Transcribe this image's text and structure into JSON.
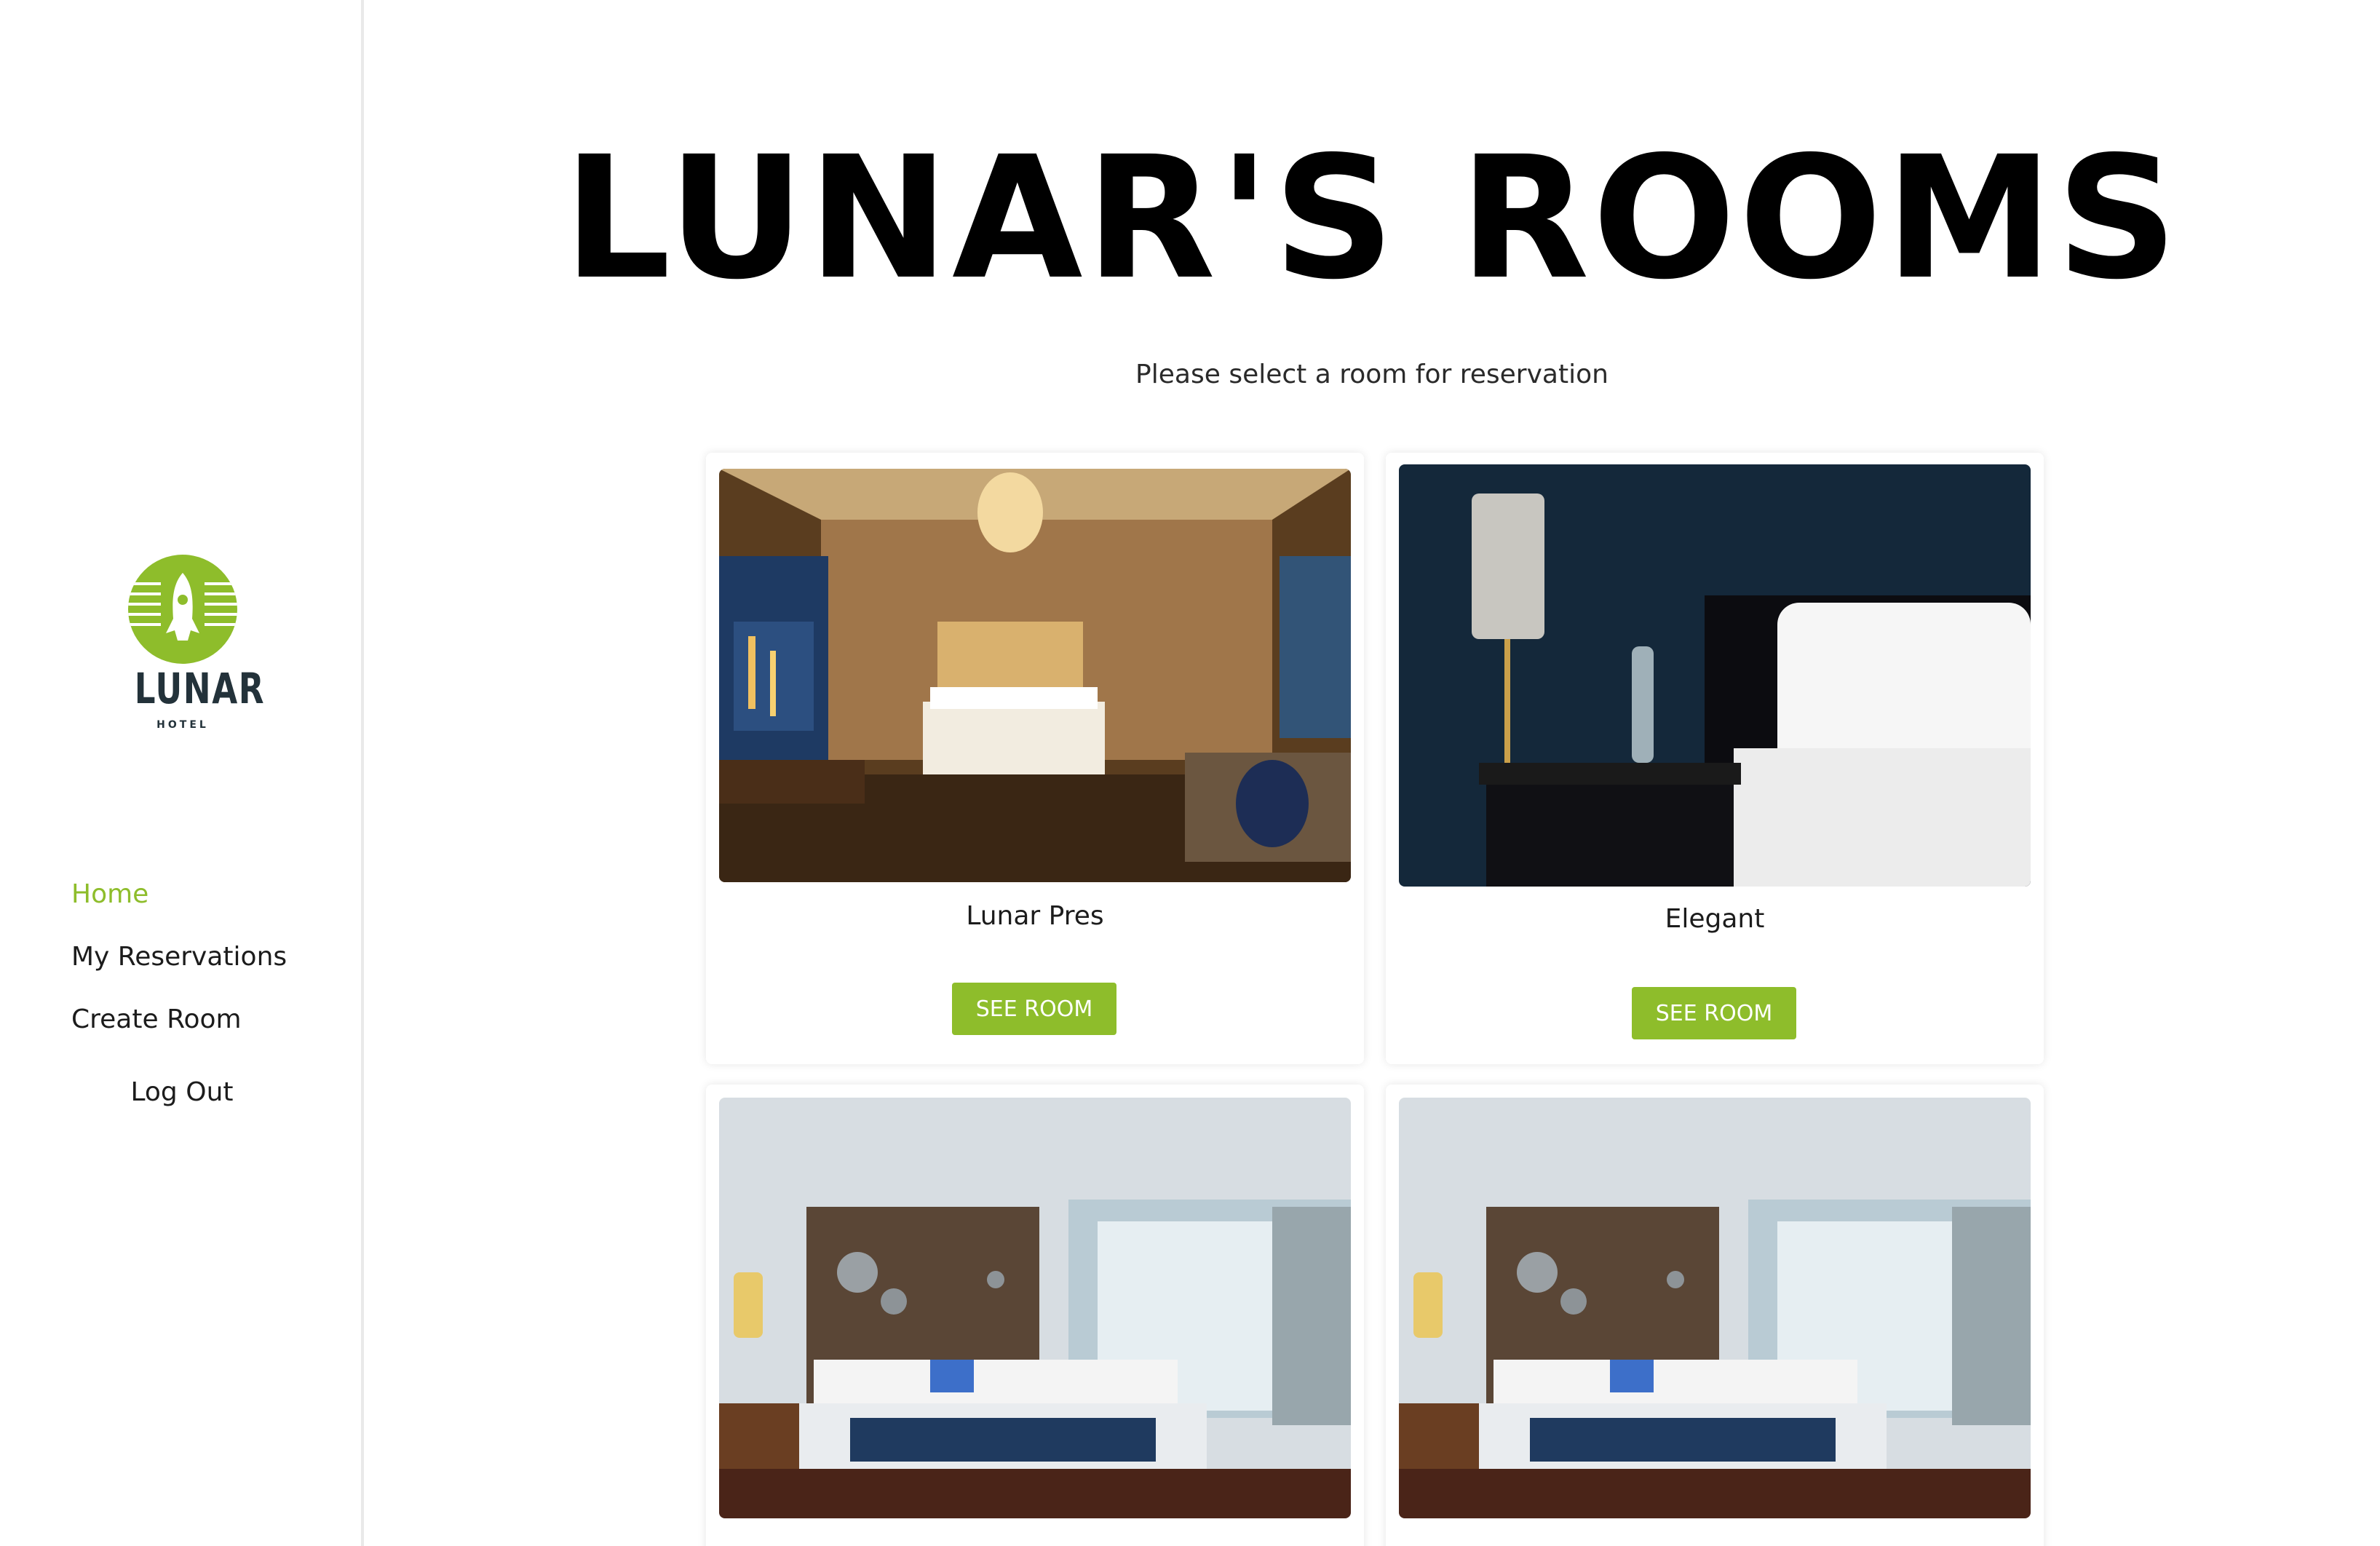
{
  "brand": {
    "name": "LUNAR",
    "sub": "HOTEL",
    "color": "#8ebd2b"
  },
  "nav": {
    "items": [
      {
        "label": "Home",
        "active": true
      },
      {
        "label": "My Reservations",
        "active": false
      },
      {
        "label": "Create Room",
        "active": false
      }
    ],
    "logout": "Log Out"
  },
  "main": {
    "title": "LUNAR'S ROOMS",
    "subtitle": "Please select a room for reservation",
    "rooms": [
      {
        "name": "Lunar Pres",
        "button": "SEE ROOM",
        "image": "luxury-suite-photo"
      },
      {
        "name": "Elegant",
        "button": "SEE ROOM",
        "image": "dark-bedroom-photo"
      },
      {
        "name": "",
        "button": "",
        "image": "blue-bedroom-photo"
      },
      {
        "name": "",
        "button": "",
        "image": "blue-bedroom-photo"
      }
    ]
  }
}
